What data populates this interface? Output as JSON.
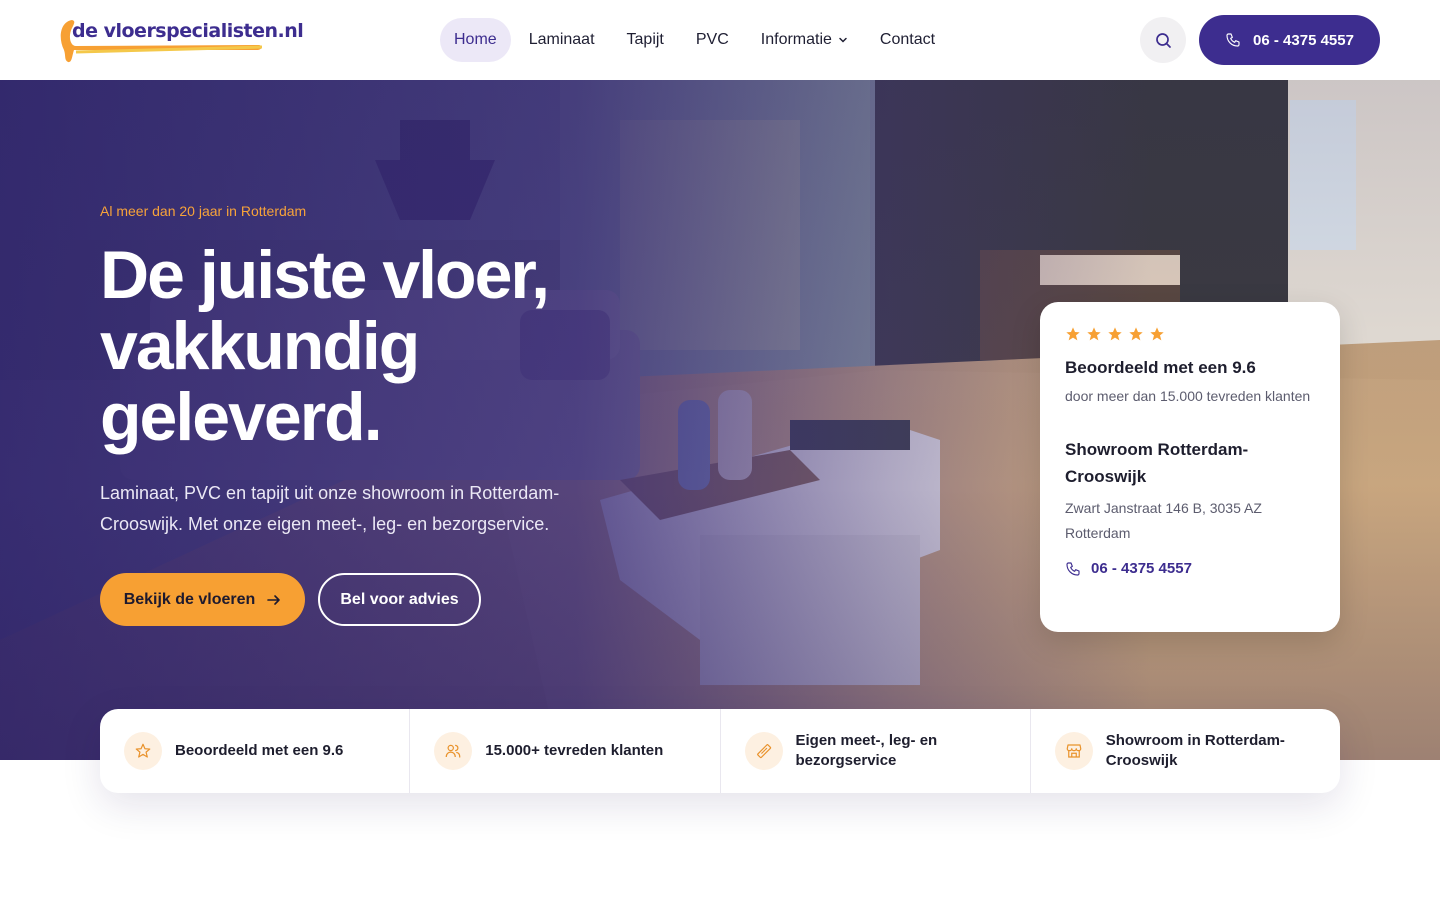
{
  "brand": {
    "logo_text": "de vloerspecialisten.nl",
    "primary_color": "#3d2d8f",
    "accent_color": "#f7a033"
  },
  "nav": {
    "items": [
      {
        "label": "Home",
        "active": true
      },
      {
        "label": "Laminaat"
      },
      {
        "label": "Tapijt"
      },
      {
        "label": "PVC"
      },
      {
        "label": "Informatie",
        "has_dropdown": true
      },
      {
        "label": "Contact"
      }
    ],
    "search_icon": "search-icon",
    "phone_label": "06 - 4375 4557"
  },
  "hero": {
    "eyebrow": "Al meer dan 20 jaar in Rotterdam",
    "title": "De juiste vloer, vakkundig geleverd.",
    "subtitle": "Laminaat, PVC en tapijt uit onze showroom in Rotterdam-Crooswijk. Met onze eigen meet-, leg- en bezorgservice.",
    "primary_button": "Bekijk de vloeren",
    "secondary_button": "Bel voor advies"
  },
  "card": {
    "rating_stars": 5,
    "rating_title": "Beoordeeld met een 9.6",
    "rating_text": "door meer dan 15.000 tevreden klanten",
    "showroom_title": "Showroom Rotterdam-Crooswijk",
    "showroom_address": "Zwart Janstraat 146 B, 3035 AZ Rotterdam",
    "phone": "06 - 4375 4557"
  },
  "features": [
    {
      "icon": "star-icon",
      "label": "Beoordeeld met een 9.6"
    },
    {
      "icon": "users-icon",
      "label": "15.000+ tevreden klanten"
    },
    {
      "icon": "ruler-icon",
      "label": "Eigen meet-, leg- en bezorgservice"
    },
    {
      "icon": "store-icon",
      "label": "Showroom in Rotterdam-Crooswijk"
    }
  ]
}
